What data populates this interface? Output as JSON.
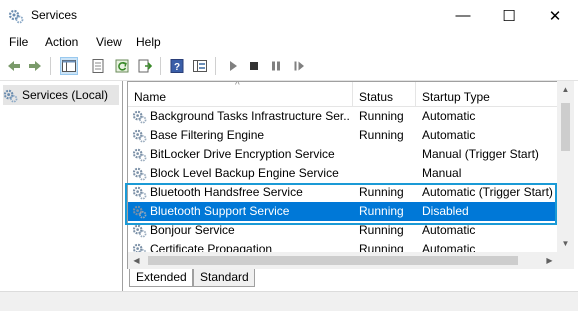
{
  "window": {
    "title": "Services"
  },
  "window_controls": {
    "minimize": "—",
    "maximize": "☐",
    "close": "✕"
  },
  "menu": [
    "File",
    "Action",
    "View",
    "Help"
  ],
  "tree": {
    "root": "Services (Local)"
  },
  "columns": {
    "name": "Name",
    "status": "Status",
    "startup": "Startup Type"
  },
  "services": [
    {
      "name": "Background Tasks Infrastructure Ser...",
      "status": "Running",
      "startup": "Automatic"
    },
    {
      "name": "Base Filtering Engine",
      "status": "Running",
      "startup": "Automatic"
    },
    {
      "name": "BitLocker Drive Encryption Service",
      "status": "",
      "startup": "Manual (Trigger Start)"
    },
    {
      "name": "Block Level Backup Engine Service",
      "status": "",
      "startup": "Manual"
    },
    {
      "name": "Bluetooth Handsfree Service",
      "status": "Running",
      "startup": "Automatic (Trigger Start)"
    },
    {
      "name": "Bluetooth Support Service",
      "status": "Running",
      "startup": "Disabled"
    },
    {
      "name": "Bonjour Service",
      "status": "Running",
      "startup": "Automatic"
    },
    {
      "name": "Certificate Propagation",
      "status": "Running",
      "startup": "Automatic"
    }
  ],
  "tabs": {
    "extended": "Extended",
    "standard": "Standard"
  },
  "colors": {
    "selection": "#0078d7",
    "highlight_box": "#1a9ad6"
  }
}
